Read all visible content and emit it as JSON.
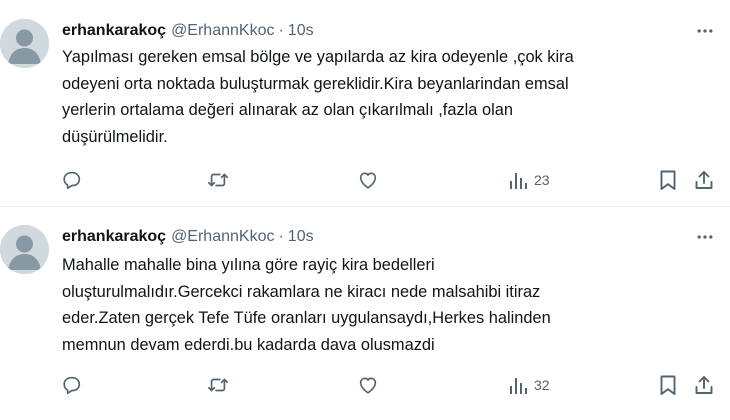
{
  "tweets": [
    {
      "name": "erhankarakoç",
      "handle": "@ErhannKkoc",
      "separator": "·",
      "time": "10s",
      "text": "Yapılması gereken emsal bölge ve yapılarda  az kira odeyenle ,çok kira\nodeyeni orta noktada buluşturmak gereklidir.Kira beyanlarindan emsal\nyerlerin ortalama değeri alınarak az olan çıkarılmalı ,fazla olan\ndüşürülmelidir.",
      "views": "23"
    },
    {
      "name": "erhankarakoç",
      "handle": "@ErhannKkoc",
      "separator": "·",
      "time": "10s",
      "text": "Mahalle mahalle bina yılına göre rayiç kira bedelleri\noluşturulmalıdır.Gercekci rakamlara ne kiracı nede malsahibi itiraz\neder.Zaten gerçek Tefe Tüfe oranları uygulansaydı,Herkes halinden\nmemnun devam ederdi.bu kadarda dava olusmazdi",
      "views": "32"
    }
  ],
  "icons": {
    "more": "more-dots-icon",
    "reply": "reply-icon",
    "retweet": "retweet-icon",
    "like": "like-icon",
    "views": "views-icon",
    "bookmark": "bookmark-icon",
    "share": "share-icon"
  },
  "colors": {
    "text": "#0f1419",
    "secondary": "#536471",
    "divider": "#eff3f4",
    "avatar_bg": "#ccd6dd"
  }
}
